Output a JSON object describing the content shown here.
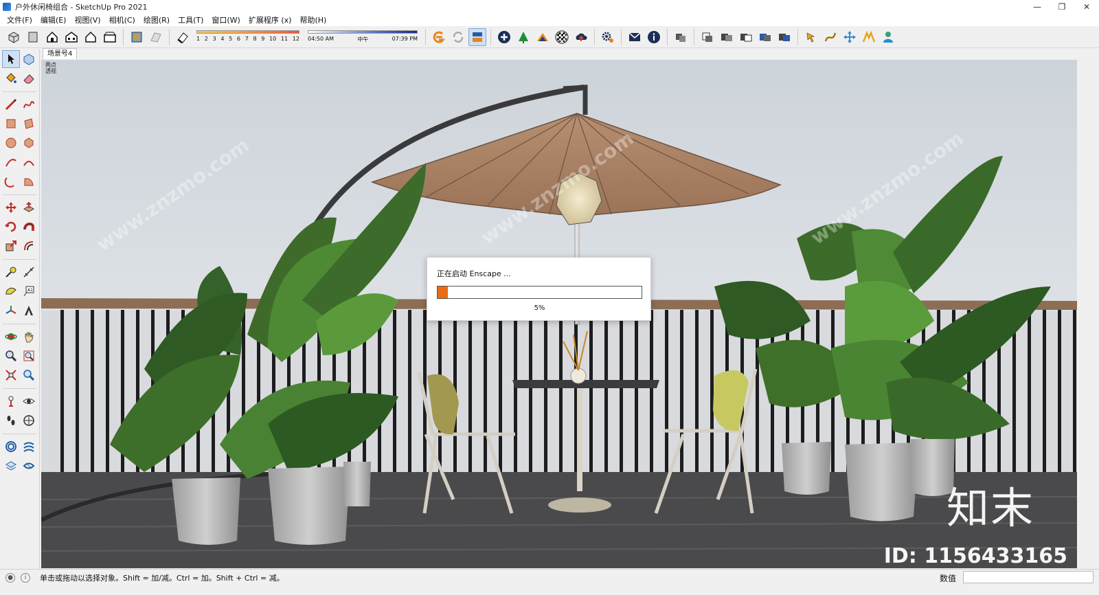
{
  "window": {
    "title": "户外休闲椅组合 - SketchUp Pro 2021",
    "minimize": "—",
    "restore": "❐",
    "close": "✕"
  },
  "menu": [
    "文件(F)",
    "编辑(E)",
    "视图(V)",
    "相机(C)",
    "绘图(R)",
    "工具(T)",
    "窗口(W)",
    "扩展程序 (x)",
    "帮助(H)"
  ],
  "shadow_settings": {
    "months": [
      "1",
      "2",
      "3",
      "4",
      "5",
      "6",
      "7",
      "8",
      "9",
      "10",
      "11",
      "12"
    ],
    "time_start": "04:50 AM",
    "time_mid": "中午",
    "time_end": "07:39 PM"
  },
  "scene_tab": "场景号4",
  "camera_label": [
    "两点",
    "透视"
  ],
  "dialog": {
    "title": "正在启动 Enscape ...",
    "progress_percent": 5,
    "progress_label": "5%"
  },
  "status": {
    "hint": "单击或拖动以选择对象。Shift = 加/减。Ctrl = 加。Shift + Ctrl = 减。",
    "measure_label": "数值",
    "measure_value": ""
  },
  "branding": {
    "logo": "知末",
    "id": "ID: 1156433165",
    "watermark": "www.znzmo.com"
  },
  "colors": {
    "umbrella": "#a98366",
    "sky": "#dfe3e8",
    "deck": "#4a4a4c",
    "progress": "#e96b12"
  }
}
